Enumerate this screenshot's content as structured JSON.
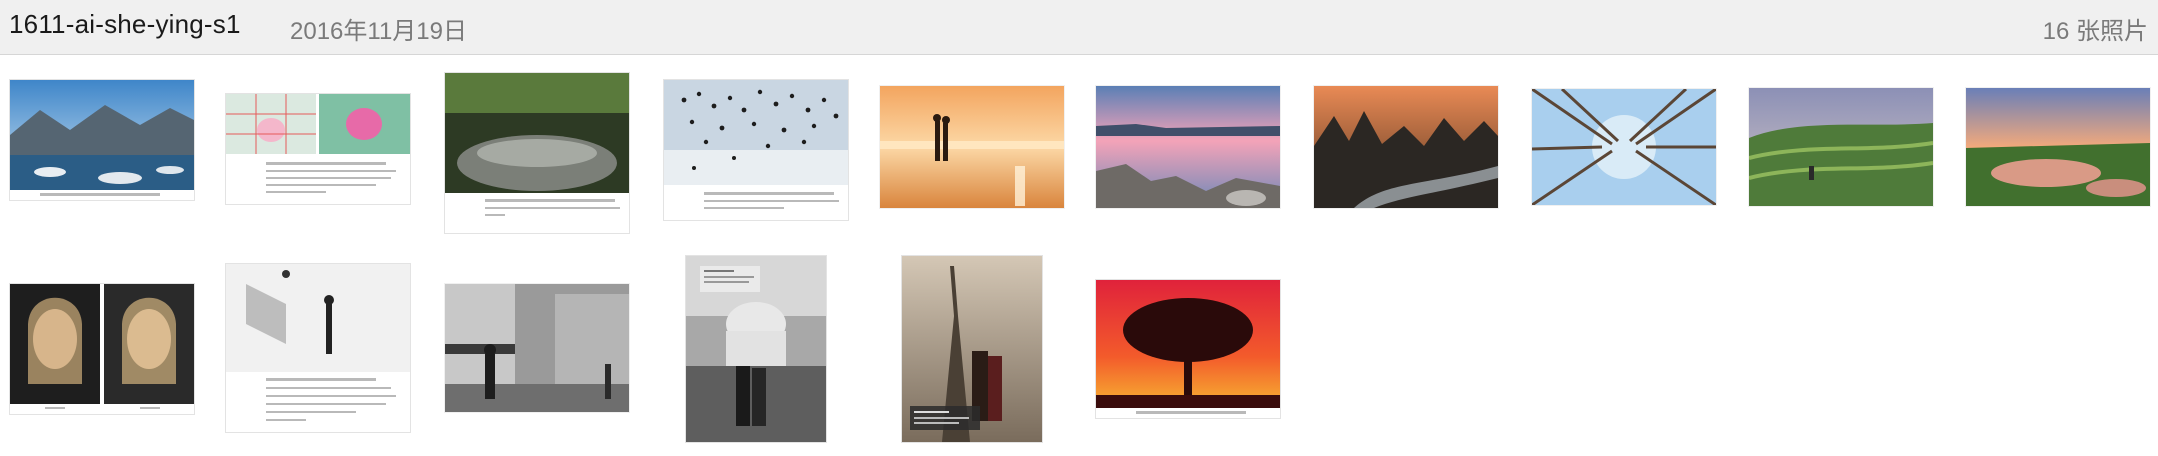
{
  "header": {
    "title": "1611-ai-she-ying-s1",
    "date": "2016年11月19日",
    "count": "16 张照片"
  },
  "photos": [
    {
      "name": "yosemite-lake"
    },
    {
      "name": "lotus-composition"
    },
    {
      "name": "sheep-flock"
    },
    {
      "name": "bird-flock"
    },
    {
      "name": "couple-beach-sunset"
    },
    {
      "name": "rocky-coast-dusk"
    },
    {
      "name": "karst-river-sunrise"
    },
    {
      "name": "trees-sky-upward"
    },
    {
      "name": "terraced-hills-farmer"
    },
    {
      "name": "terraced-pond-sunset"
    },
    {
      "name": "portrait-comparison"
    },
    {
      "name": "studio-lighting-setup"
    },
    {
      "name": "paris-street-bw"
    },
    {
      "name": "sacre-coeur-couple"
    },
    {
      "name": "eiffel-tower-couple"
    },
    {
      "name": "tree-silhouette-red"
    }
  ]
}
